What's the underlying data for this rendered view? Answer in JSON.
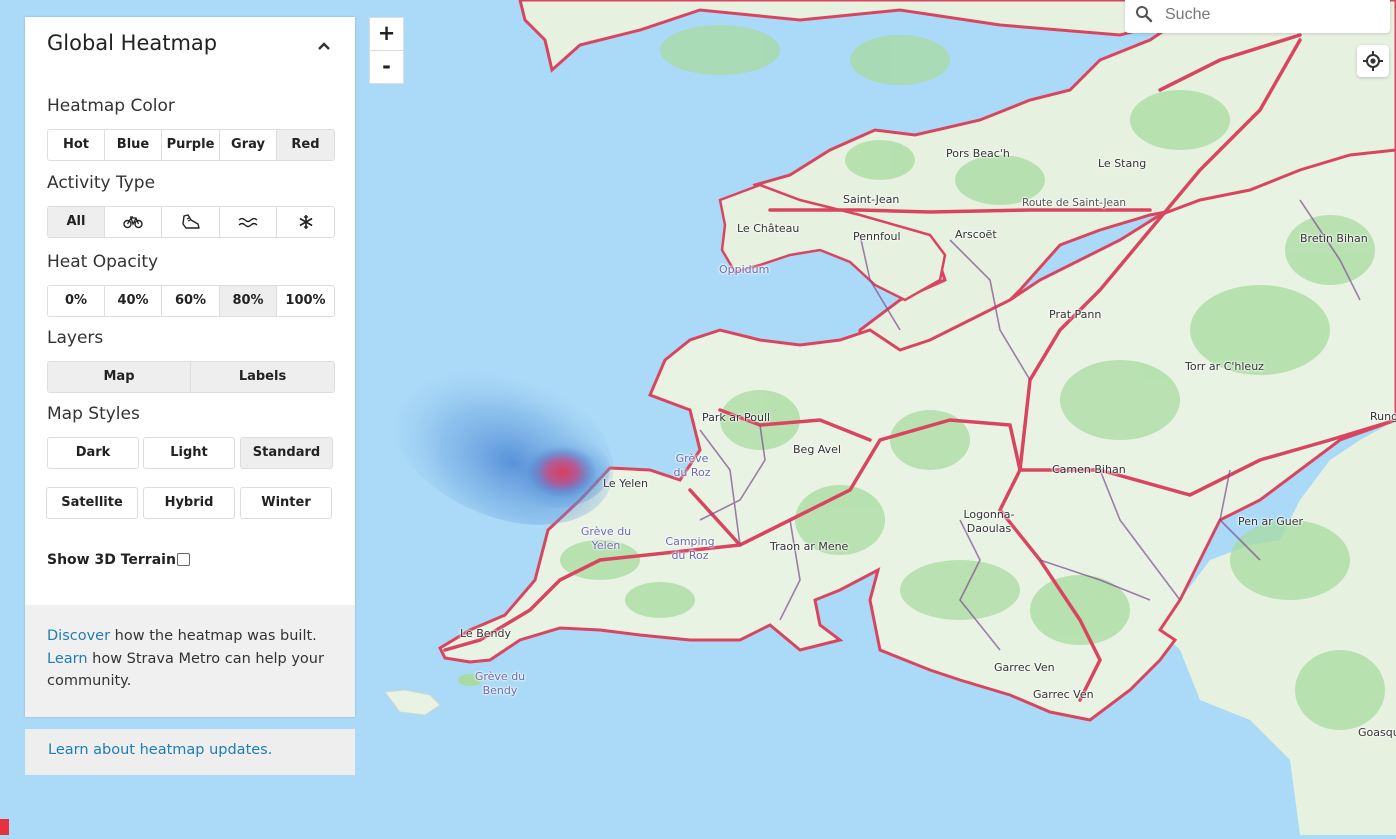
{
  "panel": {
    "title": "Global Heatmap",
    "heatmap_color": {
      "label": "Heatmap Color",
      "options": [
        "Hot",
        "Blue",
        "Purple",
        "Gray",
        "Red"
      ],
      "selected": "Red"
    },
    "activity_type": {
      "label": "Activity Type",
      "all_label": "All",
      "icons": [
        "bike-icon",
        "shoe-icon",
        "water-icon",
        "snowflake-icon"
      ],
      "selected": "All"
    },
    "heat_opacity": {
      "label": "Heat Opacity",
      "options": [
        "0%",
        "40%",
        "60%",
        "80%",
        "100%"
      ],
      "selected": "80%"
    },
    "layers": {
      "label": "Layers",
      "options": [
        "Map",
        "Labels"
      ]
    },
    "map_styles": {
      "label": "Map Styles",
      "options": [
        "Dark",
        "Light",
        "Standard",
        "Satellite",
        "Hybrid",
        "Winter"
      ],
      "selected": "Standard"
    },
    "terrain_label": "Show 3D Terrain",
    "terrain_checked": false,
    "footer": {
      "discover_link": "Discover",
      "discover_text": " how the heatmap was built.",
      "learn_link": "Learn",
      "learn_text": " how Strava Metro can help your community."
    }
  },
  "updates_link": "Learn about heatmap updates.",
  "zoom": {
    "in_label": "+",
    "out_label": "-"
  },
  "search": {
    "placeholder": "Suche"
  },
  "colors": {
    "heat": "#e23b55",
    "water": "#aadaf7",
    "land": "#e9f3e3",
    "link": "#1e7db4"
  },
  "map": {
    "places": {
      "pors_beach": "Pors Beac'h",
      "le_stang": "Le Stang",
      "saint_jean": "Saint-Jean",
      "route_saint_jean": "Route de Saint-Jean",
      "le_chateau": "Le Château",
      "pennfoul": "Pennfoul",
      "arscoet": "Arscoët",
      "bretin_bihan": "Bretin Bihan",
      "oppidum": "Oppidum",
      "prat_pann": "Prat Pann",
      "torr_ar_chleuz": "Torr ar C'hleuz",
      "rung": "Rung",
      "park_ar_poull": "Park ar Poull",
      "beg_avel": "Beg Avel",
      "greve_du_roz": "Grève du Roz",
      "camen_bihan": "Camen Bihan",
      "le_yelen": "Le Yelen",
      "greve_du_yelen": "Grève du Yelen",
      "camping_du_roz": "Camping du Roz",
      "logonna_daoulas": "Logonna-Daoulas",
      "pen_ar_guer": "Pen ar Guer",
      "traon_ar_mene": "Traon ar Mene",
      "le_bendy": "Le Bendy",
      "greve_du_bendy": "Grève du Bendy",
      "garrec_ven_1": "Garrec Ven",
      "garrec_ven_2": "Garrec Ven",
      "goasqu": "Goasqu"
    }
  }
}
